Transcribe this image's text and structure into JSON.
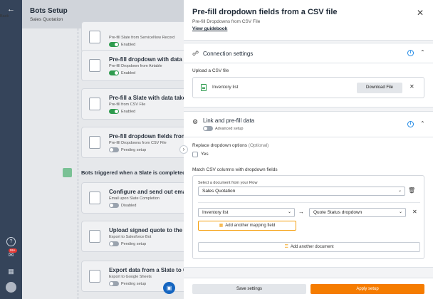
{
  "nav": {
    "back_label": "Back",
    "notification_badge": "99+"
  },
  "background": {
    "title": "Bots Setup",
    "subtitle": "Sales Quotation",
    "cards": [
      {
        "title": "",
        "subtitle": "Pre-fill Slate from ServiceNow Record",
        "status": "Enabled",
        "enabled": true
      },
      {
        "title": "Pre-fill dropdown with data ta",
        "subtitle": "Pre-fill Dropdown from Airtable",
        "status": "Enabled",
        "enabled": true
      },
      {
        "title": "Pre-fill a Slate with data taken",
        "subtitle": "Pre-fill from CSV File",
        "status": "Enabled",
        "enabled": true
      },
      {
        "title": "Pre-fill dropdown fields from a",
        "subtitle": "Pre-fill Dropdowns from CSV File",
        "status": "Pending setup",
        "enabled": false
      },
      {
        "title": "Configure and send out email",
        "subtitle": "Email upon Slate Completion",
        "status": "Disabled",
        "enabled": false
      },
      {
        "title": "Upload signed quote to the re",
        "subtitle": "Export to Salesforce Bot",
        "status": "Pending setup",
        "enabled": false
      },
      {
        "title": "Export data from a Slate to Go",
        "subtitle": "Export to Google Sheets",
        "status": "Pending setup",
        "enabled": false
      }
    ],
    "section_title": "Bots triggered when a Slate is completed"
  },
  "panel": {
    "title": "Pre-fill dropdown fields from a CSV file",
    "subtitle": "Pre-fill Dropdowns from CSV File",
    "guide_link": "View guidebook",
    "connection": {
      "title": "Connection settings",
      "upload_label": "Upload a CSV file",
      "file_name": "Inventory list",
      "download_label": "Download File"
    },
    "link": {
      "title": "Link and pre-fill data",
      "advanced_label": "Advanced setup",
      "replace_label": "Replace dropdown options",
      "replace_optional": "(Optional)",
      "yes_label": "Yes",
      "match_label": "Match CSV columns with dropdown fields",
      "doc_select_label": "Select a document from your Flow",
      "doc_selected": "Sales Quotation",
      "csv_column": "Inventory list",
      "dropdown_field": "Quote Status dropdown",
      "add_mapping": "Add another mapping field",
      "add_document": "Add another document"
    },
    "footer": {
      "save": "Save settings",
      "apply": "Apply setup"
    }
  }
}
